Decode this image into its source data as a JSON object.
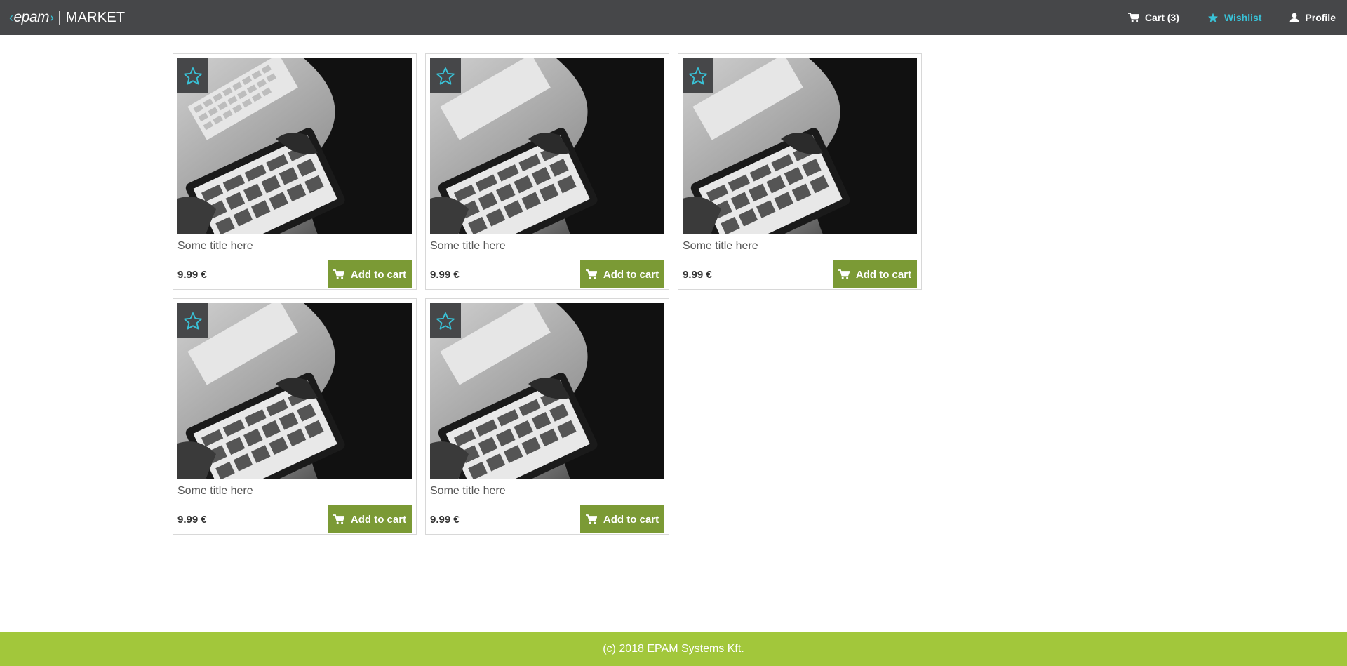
{
  "header": {
    "logo_text": "epam",
    "separator": "|",
    "app_name": "MARKET",
    "nav": [
      {
        "label": "Cart (3)",
        "icon": "cart-icon",
        "active": false
      },
      {
        "label": "Wishlist",
        "icon": "star-icon",
        "active": true
      },
      {
        "label": "Profile",
        "icon": "user-icon",
        "active": false
      }
    ]
  },
  "colors": {
    "topbar": "#464749",
    "accent": "#39c2d7",
    "button": "#7b9a35",
    "footer": "#a2c73b"
  },
  "products": [
    {
      "title": "Some title here",
      "price": "9.99 €",
      "button_label": "Add to cart"
    },
    {
      "title": "Some title here",
      "price": "9.99 €",
      "button_label": "Add to cart"
    },
    {
      "title": "Some title here",
      "price": "9.99 €",
      "button_label": "Add to cart"
    },
    {
      "title": "Some title here",
      "price": "9.99 €",
      "button_label": "Add to cart"
    },
    {
      "title": "Some title here",
      "price": "9.99 €",
      "button_label": "Add to cart"
    }
  ],
  "footer": {
    "text": "(c) 2018 EPAM Systems Kft."
  }
}
